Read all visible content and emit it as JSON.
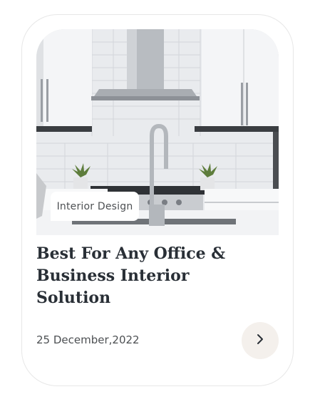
{
  "card": {
    "category": "Interior Design",
    "title": "Best For Any Office & Business Interior Solution",
    "date": "25 December,2022",
    "next_icon": "chevron-right-icon"
  },
  "image": {
    "subject": "kitchen-photo"
  },
  "colors": {
    "title": "#292f36",
    "muted_text": "#4d5053",
    "button_bg": "#f4f0ec",
    "card_border": "#e7e7e7"
  }
}
